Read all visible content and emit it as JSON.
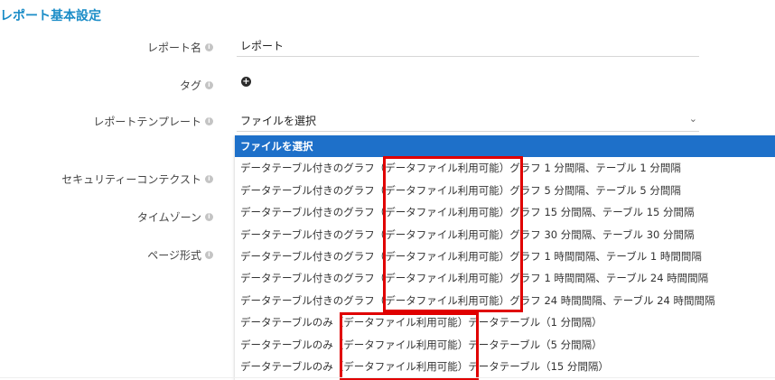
{
  "section": {
    "title": "レポート基本設定"
  },
  "fields": {
    "report_name": {
      "label": "レポート名",
      "value": "レポート"
    },
    "tag": {
      "label": "タグ",
      "add_icon": "plus-circle-icon"
    },
    "template": {
      "label": "レポートテンプレート",
      "value": "ファイルを選択"
    },
    "security_context": {
      "label": "セキュリティーコンテクスト"
    },
    "timezone": {
      "label": "タイムゾーン"
    },
    "page_format": {
      "label": "ページ形式"
    }
  },
  "dropdown": {
    "options": [
      "ファイルを選択",
      "データテーブル付きのグラフ（データファイル利用可能）グラフ 1 分間隔、テーブル 1 分間隔",
      "データテーブル付きのグラフ（データファイル利用可能）グラフ 5 分間隔、テーブル 5 分間隔",
      "データテーブル付きのグラフ（データファイル利用可能）グラフ 15 分間隔、テーブル 15 分間隔",
      "データテーブル付きのグラフ（データファイル利用可能）グラフ 30 分間隔、テーブル 30 分間隔",
      "データテーブル付きのグラフ（データファイル利用可能）グラフ 1 時間間隔、テーブル 1 時間間隔",
      "データテーブル付きのグラフ（データファイル利用可能）グラフ 1 時間間隔、テーブル 24 時間間隔",
      "データテーブル付きのグラフ（データファイル利用可能）グラフ 24 時間間隔、テーブル 24 時間間隔",
      "データテーブルのみ（データファイル利用可能）データテーブル（1 分間隔）",
      "データテーブルのみ（データファイル利用可能）データテーブル（5 分間隔）",
      "データテーブルのみ（データファイル利用可能）データテーブル（15 分間隔）"
    ]
  },
  "colors": {
    "accent": "#1a8cc7",
    "selected": "#1e70c9",
    "highlight": "#e00000"
  }
}
